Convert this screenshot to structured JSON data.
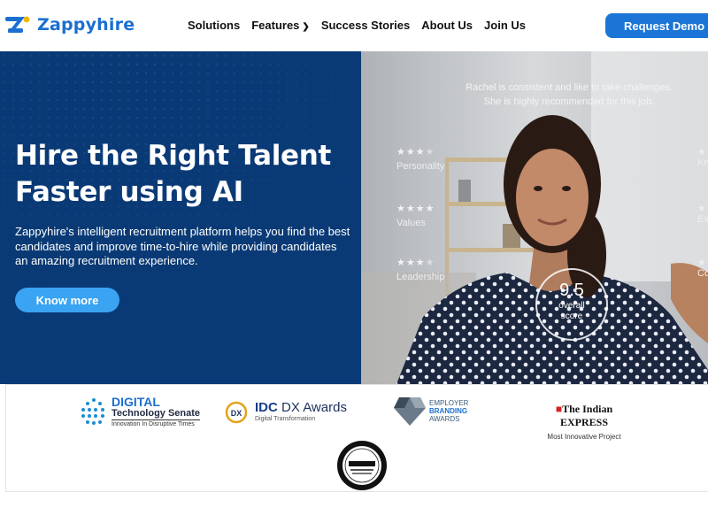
{
  "header": {
    "logo_text": "Zappyhire",
    "nav": [
      {
        "label": "Solutions",
        "has_dropdown": false
      },
      {
        "label": "Features",
        "has_dropdown": true
      },
      {
        "label": "Success Stories",
        "has_dropdown": false
      },
      {
        "label": "About Us",
        "has_dropdown": false
      },
      {
        "label": "Join Us",
        "has_dropdown": false
      }
    ],
    "cta_label": "Request Demo"
  },
  "hero": {
    "title_line1": "Hire the Right Talent",
    "title_line2": "Faster using AI",
    "subtitle": "Zappyhire's intelligent recruitment platform helps you find the best candidates and improve time-to-hire while providing candidates an amazing recruitment experience.",
    "button_label": "Know more"
  },
  "photo_overlay": {
    "quote_line1": "Rachel is consistent and like to take challenges.",
    "quote_line2": "She is highly recommended for this job.",
    "traits": [
      {
        "label": "Personality",
        "stars": 3
      },
      {
        "label": "Values",
        "stars": 4
      },
      {
        "label": "Leadership",
        "stars": 3
      }
    ],
    "traits_right": [
      "Kn",
      "Ex",
      "Co"
    ],
    "score_value": "9.5",
    "score_label_1": "overall",
    "score_label_2": "score"
  },
  "awards": {
    "dts": {
      "line1": "DIGITAL",
      "line2": "Technology Senate",
      "line3": "Innovation In Disruptive Times"
    },
    "idc": {
      "line1_a": "IDC",
      "line1_b": "DX Awards",
      "line2": "Digital Transformation"
    },
    "employer": {
      "line1": "EMPLOYER",
      "line2": "BRANDING",
      "line3": "AWARDS"
    },
    "indian_express": {
      "line1_a": "The Indian",
      "line1_b": "EXPRESS",
      "line2": "Most Innovative Project"
    }
  },
  "colors": {
    "brand_blue": "#1b6fd0",
    "hero_navy": "#0a3a75",
    "button_light_blue": "#3aa3f2"
  }
}
